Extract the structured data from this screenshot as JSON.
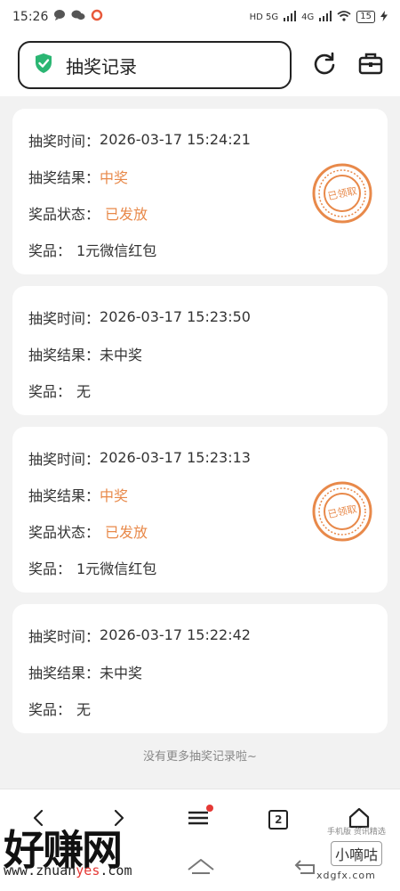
{
  "status_bar": {
    "time": "15:26",
    "signal_1": "HD 5G",
    "signal_2": "4G",
    "battery": "15"
  },
  "header": {
    "title": "抽奖记录",
    "icons": [
      "shield-check-icon",
      "refresh-icon",
      "toolbox-icon"
    ]
  },
  "records": [
    {
      "time_label": "抽奖时间：",
      "time_value": "2026-03-17 15:24:21",
      "result_label": "抽奖结果：",
      "result_value": "中奖",
      "status_label": "奖品状态：",
      "status_value": "已发放",
      "prize_label": "奖品：",
      "prize_value": "1元微信红包",
      "stamp_text": "已领取"
    },
    {
      "time_label": "抽奖时间：",
      "time_value": "2026-03-17 15:23:50",
      "result_label": "抽奖结果：",
      "result_value": "未中奖",
      "prize_label": "奖品：",
      "prize_value": "无"
    },
    {
      "time_label": "抽奖时间：",
      "time_value": "2026-03-17 15:23:13",
      "result_label": "抽奖结果：",
      "result_value": "中奖",
      "status_label": "奖品状态：",
      "status_value": "已发放",
      "prize_label": "奖品：",
      "prize_value": "1元微信红包",
      "stamp_text": "已领取"
    },
    {
      "time_label": "抽奖时间：",
      "time_value": "2026-03-17 15:22:42",
      "result_label": "抽奖结果：",
      "result_value": "未中奖",
      "prize_label": "奖品：",
      "prize_value": "无"
    }
  ],
  "footer_note": "没有更多抽奖记录啦~",
  "bottom_nav": {
    "tab_count": "2",
    "icons": [
      "back-icon",
      "forward-icon",
      "menu-icon",
      "tabs-icon",
      "home-icon"
    ]
  },
  "watermarks": {
    "left_title": "好赚网",
    "left_url_a": "www.zhuan",
    "left_url_b": "yes",
    "left_url_c": ".com",
    "right_small": "手机版 资讯精选",
    "right_title": "小嘀咕",
    "right_url": "xdgfx.com"
  },
  "colors": {
    "accent_orange": "#e8894a",
    "shield_green": "#2bb673"
  }
}
